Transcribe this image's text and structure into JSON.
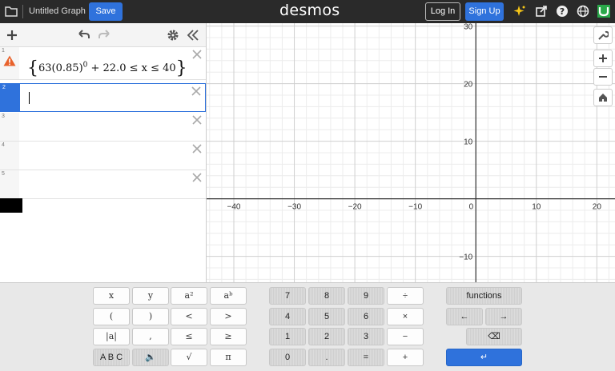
{
  "header": {
    "title": "Untitled Graph",
    "save_label": "Save",
    "logo": "desmos",
    "login_label": "Log In",
    "signup_label": "Sign Up",
    "icons": [
      "folder-icon",
      "sparkle-icon",
      "share-icon",
      "help-icon",
      "globe-icon",
      "user-avatar-icon"
    ]
  },
  "expressions": [
    {
      "num": "1",
      "warning": true,
      "latex_parts": {
        "coef": "63",
        "base": "(0.85)",
        "exp": "0",
        "rest": " + 22.0 ≤ x ≤ 40"
      }
    },
    {
      "num": "2",
      "active": true
    },
    {
      "num": "3"
    },
    {
      "num": "4"
    },
    {
      "num": "5"
    }
  ],
  "graph": {
    "x_ticks": [
      "−40",
      "−30",
      "−20",
      "−10",
      "0",
      "10",
      "20"
    ],
    "y_ticks": [
      "30",
      "20",
      "10",
      "−10"
    ],
    "x_range": [
      -44.5,
      23
    ],
    "y_range": [
      -14.5,
      30.5
    ]
  },
  "keypad": {
    "left": [
      [
        "x",
        "y",
        "a²",
        "aᵇ"
      ],
      [
        "(",
        ")",
        "<",
        ">"
      ],
      [
        "|a|",
        ",",
        "≤",
        "≥"
      ],
      [
        "A B C",
        "🔈",
        "√",
        "π"
      ]
    ],
    "num": [
      [
        "7",
        "8",
        "9",
        "÷"
      ],
      [
        "4",
        "5",
        "6",
        "×"
      ],
      [
        "1",
        "2",
        "3",
        "−"
      ],
      [
        "0",
        ".",
        "=",
        "+"
      ]
    ],
    "functions_label": "functions",
    "left_arrow": "←",
    "right_arrow": "→",
    "backspace": "⌫",
    "enter": "↵"
  }
}
